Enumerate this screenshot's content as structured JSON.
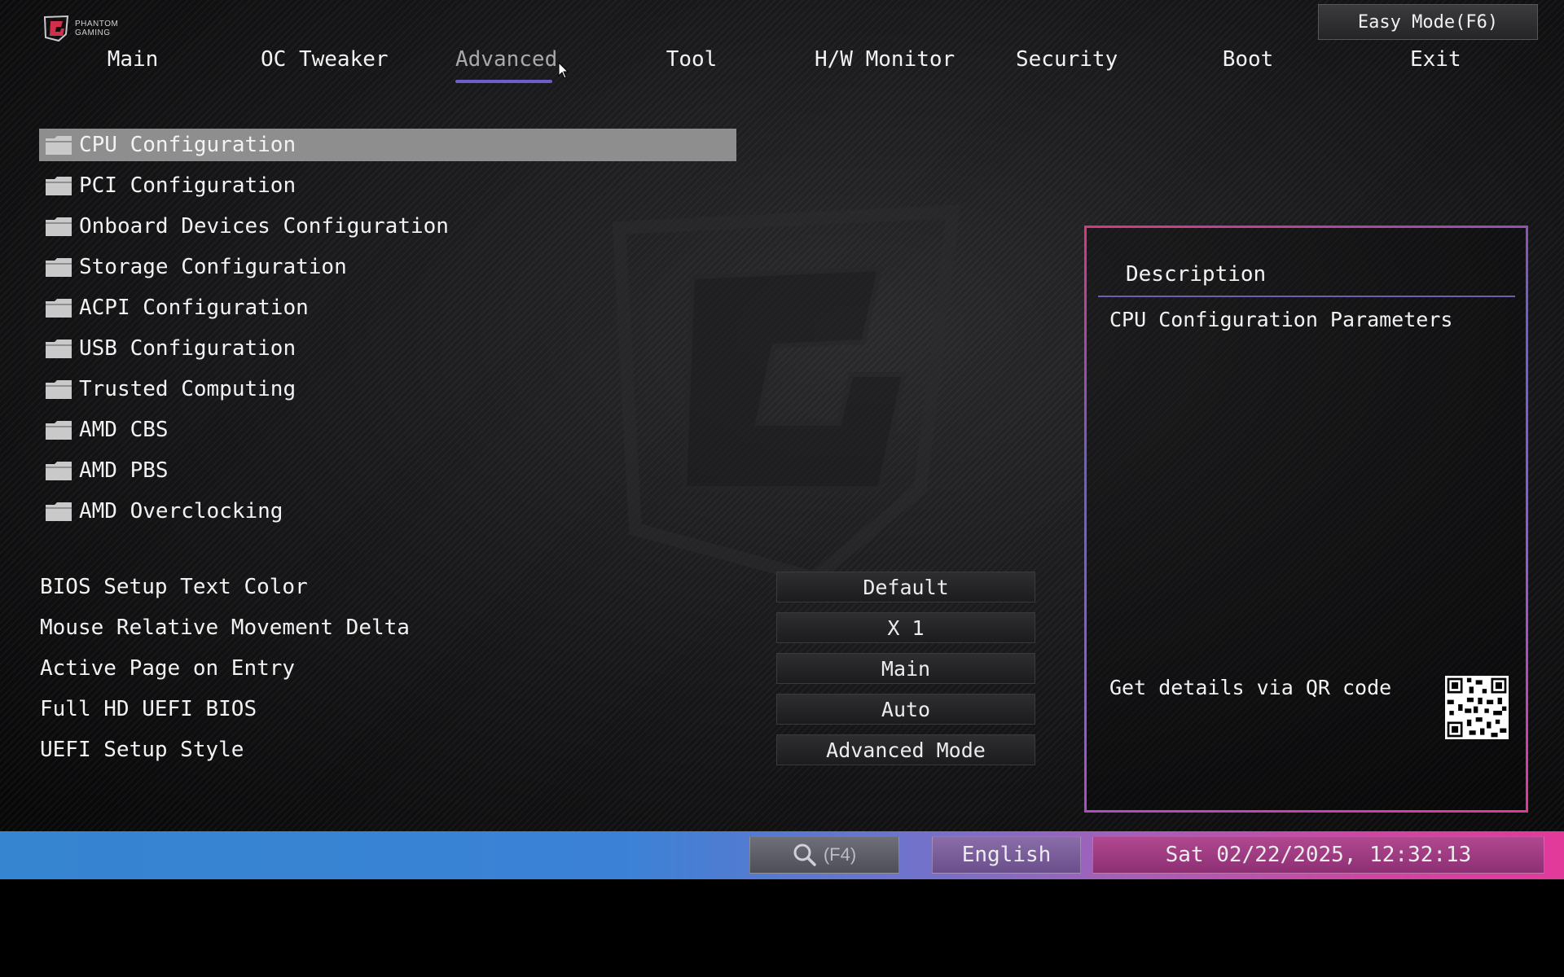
{
  "brand": {
    "line1": "PHANTOM",
    "line2": "GAMING"
  },
  "header": {
    "easy_mode": "Easy Mode(F6)"
  },
  "nav": {
    "tabs": [
      {
        "label": "Main"
      },
      {
        "label": "OC Tweaker"
      },
      {
        "label": "Advanced",
        "active": true
      },
      {
        "label": "Tool"
      },
      {
        "label": "H/W Monitor"
      },
      {
        "label": "Security"
      },
      {
        "label": "Boot"
      },
      {
        "label": "Exit"
      }
    ]
  },
  "menu": {
    "items": [
      {
        "label": "CPU Configuration",
        "selected": true
      },
      {
        "label": "PCI Configuration"
      },
      {
        "label": "Onboard Devices Configuration"
      },
      {
        "label": "Storage Configuration"
      },
      {
        "label": "ACPI Configuration"
      },
      {
        "label": "USB Configuration"
      },
      {
        "label": "Trusted Computing"
      },
      {
        "label": "AMD CBS"
      },
      {
        "label": "AMD PBS"
      },
      {
        "label": "AMD Overclocking"
      }
    ]
  },
  "settings": [
    {
      "label": "BIOS Setup Text Color",
      "value": "Default"
    },
    {
      "label": "Mouse Relative Movement Delta",
      "value": "X 1"
    },
    {
      "label": "Active Page on Entry",
      "value": "Main"
    },
    {
      "label": "Full HD UEFI BIOS",
      "value": "Auto"
    },
    {
      "label": "UEFI Setup Style",
      "value": "Advanced Mode"
    }
  ],
  "description": {
    "title": "Description",
    "text": "CPU Configuration Parameters",
    "qr_label": "Get details via QR code"
  },
  "footer": {
    "search_hint": "(F4)",
    "language": "English",
    "datetime": "Sat 02/22/2025, 12:32:13"
  },
  "icons": {
    "folder": "folder-icon",
    "search": "search-icon",
    "qr": "qr-code-icon"
  },
  "colors": {
    "accent": "#6c5fc9",
    "panel_border": "#d8387f",
    "footer_left": "#3585d0",
    "footer_right": "#e23a9b",
    "selected_row": "#8e8e8e"
  }
}
